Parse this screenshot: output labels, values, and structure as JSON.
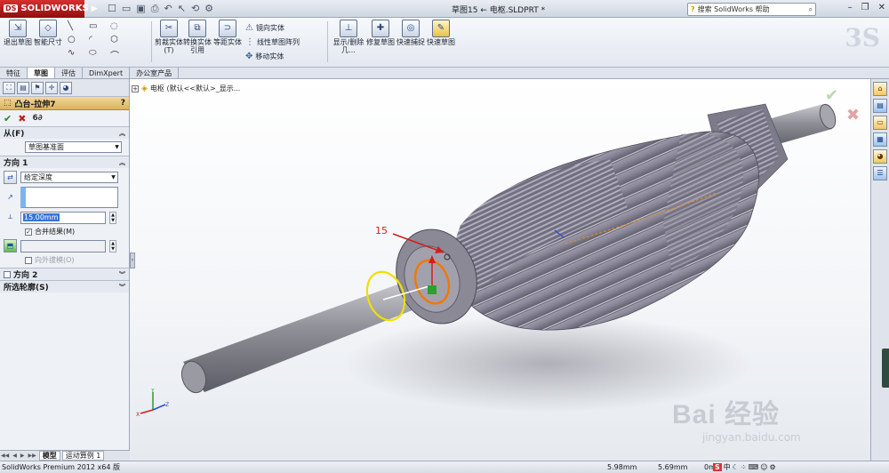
{
  "app": {
    "brand": "SOLIDWORKS",
    "doc_title": "草图15 ← 电枢.SLDPRT *",
    "help_placeholder": "搜索 SolidWorks 帮助",
    "help_prefix": "?"
  },
  "toolbar": {
    "exit_sketch": "退出草图",
    "smart_dimension": "智能尺寸",
    "trim_entities": "剪裁实体(T)",
    "convert_entities": "转换实体引用",
    "offset_entities": "等距实体",
    "mirror_entities": "镜向实体",
    "linear_pattern": "线性草图阵列",
    "move_entities": "移动实体",
    "display_delete_relations": "显示/删除几...",
    "repair_sketch": "修复草图",
    "quick_snaps": "快速捕捉",
    "rapid_sketch": "快速草图"
  },
  "tabs": [
    "特征",
    "草图",
    "评估",
    "DimXpert",
    "办公室产品"
  ],
  "active_tab": 1,
  "property_manager": {
    "title": "凸台-拉伸7",
    "help": "?",
    "from_label": "从(F)",
    "from_value": "草图基准面",
    "direction1_label": "方向 1",
    "end_condition": "给定深度",
    "depth_value": "15.00mm",
    "merge_result": "合并结果(M)",
    "draft_outward": "向外拔模(O)",
    "direction2_label": "方向 2",
    "selected_contours": "所选轮廓(S)"
  },
  "bottom_tabs": [
    "模型",
    "运动算例 1"
  ],
  "tree": {
    "part_label": "电枢 (默认<<默认>_显示..."
  },
  "viewport": {
    "dimension_text": "15"
  },
  "watermark": {
    "main": "Bai 经验",
    "sub": "jingyan.baidu.com"
  },
  "status": {
    "app_name": "SolidWorks Premium 2012 x64 版",
    "x_value": "5.98mm",
    "y_value": "5.69mm",
    "z_value": "0m",
    "ime_text": "中"
  },
  "colors": {
    "accent_red": "#d21d1d",
    "brand_red": "#b31616",
    "pm_header": "#d9b35c",
    "selection_yellow": "#f0e000",
    "selection_orange": "#f07800"
  }
}
